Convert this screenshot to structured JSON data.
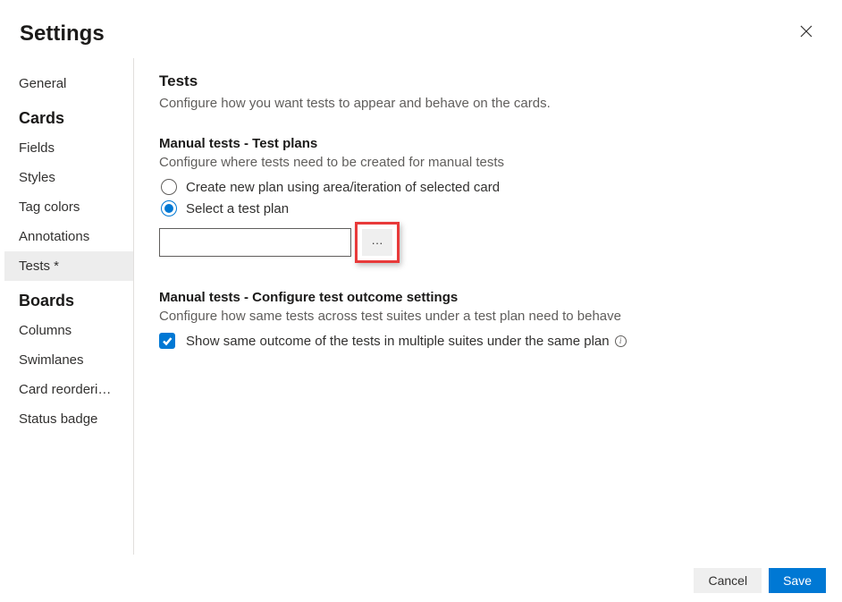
{
  "header": {
    "title": "Settings"
  },
  "sidebar": {
    "general": {
      "label": "General"
    },
    "cards": {
      "title": "Cards",
      "items": [
        {
          "label": "Fields"
        },
        {
          "label": "Styles"
        },
        {
          "label": "Tag colors"
        },
        {
          "label": "Annotations"
        },
        {
          "label": "Tests *"
        }
      ]
    },
    "boards": {
      "title": "Boards",
      "items": [
        {
          "label": "Columns"
        },
        {
          "label": "Swimlanes"
        },
        {
          "label": "Card reorderi…"
        },
        {
          "label": "Status badge"
        }
      ]
    }
  },
  "main": {
    "tests": {
      "title": "Tests",
      "desc": "Configure how you want tests to appear and behave on the cards."
    },
    "testplans": {
      "title": "Manual tests - Test plans",
      "desc": "Configure where tests need to be created for manual tests",
      "option_create": "Create new plan using area/iteration of selected card",
      "option_select": "Select a test plan",
      "input_value": "",
      "browse_label": "···"
    },
    "outcome": {
      "title": "Manual tests - Configure test outcome settings",
      "desc": "Configure how same tests across test suites under a test plan need to behave",
      "checkbox_label": "Show same outcome of the tests in multiple suites under the same plan"
    }
  },
  "footer": {
    "cancel": "Cancel",
    "save": "Save"
  }
}
